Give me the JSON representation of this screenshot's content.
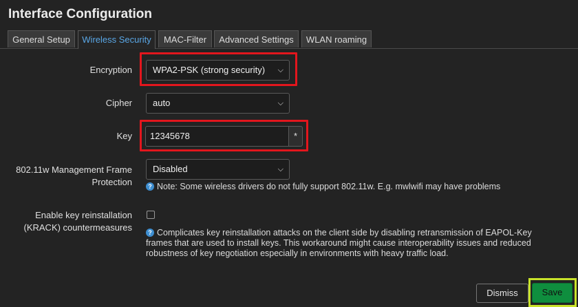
{
  "page": {
    "title": "Interface Configuration"
  },
  "tabs": [
    {
      "label": "General Setup",
      "active": false
    },
    {
      "label": "Wireless Security",
      "active": true
    },
    {
      "label": "MAC-Filter",
      "active": false
    },
    {
      "label": "Advanced Settings",
      "active": false
    },
    {
      "label": "WLAN roaming",
      "active": false
    }
  ],
  "form": {
    "encryption": {
      "label": "Encryption",
      "value": "WPA2-PSK (strong security)"
    },
    "cipher": {
      "label": "Cipher",
      "value": "auto"
    },
    "key": {
      "label": "Key",
      "value": "12345678",
      "reveal_glyph": "*"
    },
    "mfp": {
      "label_line1": "802.11w Management Frame",
      "label_line2": "Protection",
      "value": "Disabled",
      "help": "Note: Some wireless drivers do not fully support 802.11w. E.g. mwlwifi may have problems"
    },
    "krack": {
      "label_line1": "Enable key reinstallation",
      "label_line2": "(KRACK) countermeasures",
      "checked": false,
      "help_line1": "Complicates key reinstallation attacks on the client side by disabling retransmission of EAPOL-Key",
      "help_line2": "frames that are used to install keys. This workaround might cause interoperability issues and reduced",
      "help_line3": "robustness of key negotiation especially in environments with heavy traffic load."
    }
  },
  "footer": {
    "dismiss_label": "Dismiss",
    "save_label": "Save"
  },
  "colors": {
    "accent": "#5aa7e6",
    "highlight_red": "#e3161d",
    "highlight_yellow": "#c9e32a",
    "save_green": "#0f8e3e"
  },
  "icons": {
    "chevron": "chevron-down-icon",
    "help": "help-circle-icon"
  }
}
